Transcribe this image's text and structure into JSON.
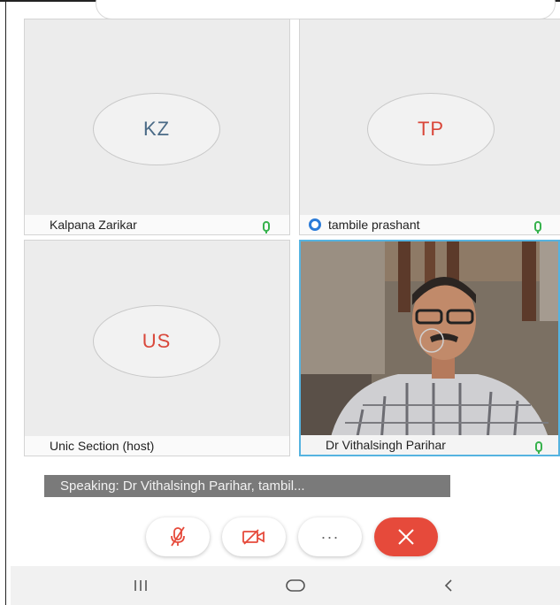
{
  "participants": [
    {
      "name": "Kalpana Zarikar",
      "initials": "KZ",
      "initials_color": "#4a6a86"
    },
    {
      "name": "tambile prashant",
      "initials": "TP",
      "initials_color": "#d9473a"
    },
    {
      "name": "Unic Section (host)",
      "initials": "US",
      "initials_color": "#d9473a"
    },
    {
      "name": "Dr Vithalsingh Parihar",
      "video": true
    }
  ],
  "speaking_text": "Speaking: Dr Vithalsingh Parihar, tambil...",
  "controls": {
    "mute_icon": "mic-muted-icon",
    "video_icon": "video-off-icon",
    "more_label": "···",
    "end_icon": "close-icon",
    "end_color": "#e64a3b"
  },
  "navbar": {
    "recents_icon": "recents-icon",
    "home_icon": "home-icon",
    "back_icon": "back-icon"
  },
  "colors": {
    "mic_active": "#37b24d",
    "active_border": "#55b3e0",
    "presence": "#2b7bd8"
  }
}
